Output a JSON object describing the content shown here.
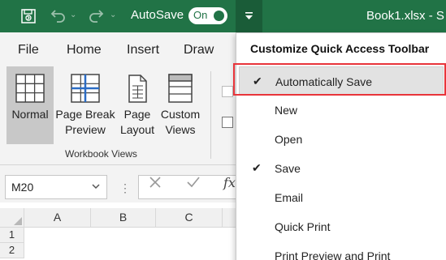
{
  "titlebar": {
    "autosave_label": "AutoSave",
    "autosave_toggle": "On",
    "document_title": "Book1.xlsx  -  S"
  },
  "tabs": [
    "File",
    "Home",
    "Insert",
    "Draw"
  ],
  "ribbon": {
    "buttons": [
      {
        "label_line1": "Normal",
        "label_line2": ""
      },
      {
        "label_line1": "Page Break",
        "label_line2": "Preview"
      },
      {
        "label_line1": "Page",
        "label_line2": "Layout"
      },
      {
        "label_line1": "Custom",
        "label_line2": "Views"
      }
    ],
    "group_label": "Workbook Views"
  },
  "formula_bar": {
    "name_box": "M20",
    "fx_symbol": "fx",
    "dots": "⋮"
  },
  "grid": {
    "columns": [
      "A",
      "B",
      "C"
    ],
    "rows": [
      "1",
      "2"
    ]
  },
  "dropdown": {
    "header": "Customize Quick Access Toolbar",
    "items": [
      {
        "label": "Automatically Save",
        "checked": true,
        "highlighted": true
      },
      {
        "label": "New",
        "checked": false
      },
      {
        "label": "Open",
        "checked": false
      },
      {
        "label": "Save",
        "checked": true
      },
      {
        "label": "Email",
        "checked": false
      },
      {
        "label": "Quick Print",
        "checked": false
      },
      {
        "label": "Print Preview and Print",
        "checked": false
      }
    ],
    "check_glyph": "✔"
  },
  "colors": {
    "title_green": "#217346",
    "highlight_red": "#e8343a"
  }
}
